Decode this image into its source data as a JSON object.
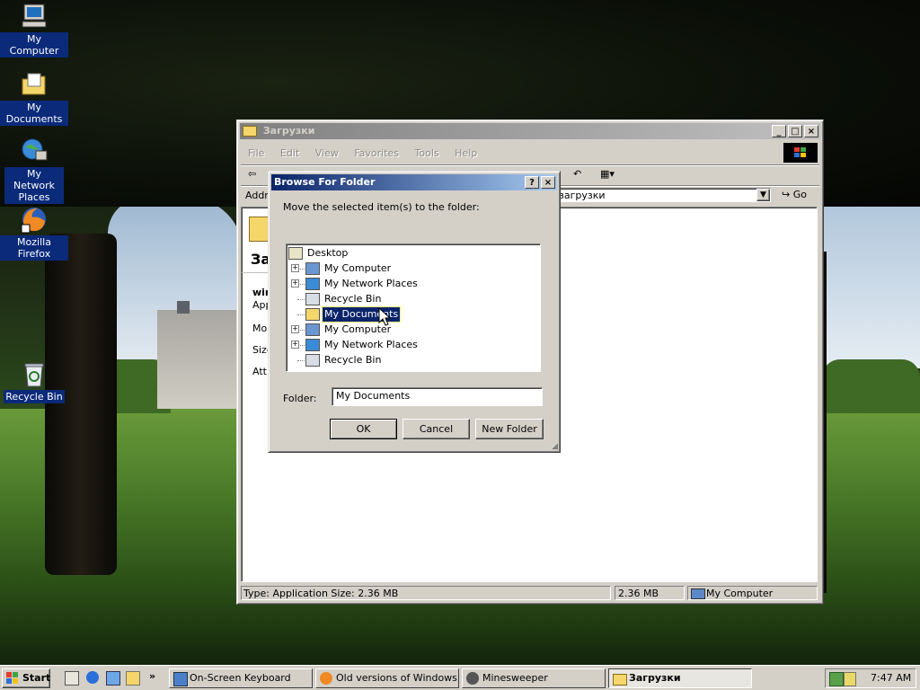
{
  "desktop": {
    "icons": [
      {
        "label": "My Computer",
        "icon": "my-computer-icon"
      },
      {
        "label": "My Documents",
        "icon": "folder-documents-icon"
      },
      {
        "label": "My Network Places",
        "icon": "network-places-icon"
      },
      {
        "label": "Mozilla Firefox",
        "icon": "firefox-icon"
      },
      {
        "label": "Recycle Bin",
        "icon": "recycle-bin-icon"
      }
    ]
  },
  "explorer": {
    "title": "Загрузки",
    "menu": [
      "File",
      "Edit",
      "View",
      "Favorites",
      "Tools",
      "Help"
    ],
    "address_label": "Addr",
    "address_value": "загрузки",
    "go_label": "Go",
    "left_pane": {
      "folder_label_partial": "За",
      "file_name_partial": "win",
      "file_type_partial": "App",
      "modified_partial": "Mo",
      "size_partial": "Size",
      "attributes_partial": "Attr"
    },
    "status": {
      "type_size": "Type: Application Size: 2.36 MB",
      "size": "2.36 MB",
      "zone": "My Computer"
    }
  },
  "dialog": {
    "title": "Browse For Folder",
    "help_btn": "?",
    "close_btn": "×",
    "instruction": "Move the selected item(s) to the folder:",
    "tree": [
      {
        "label": "Desktop",
        "icon": "desktop-icon",
        "level": 0,
        "expander": false,
        "selected": false
      },
      {
        "label": "My Computer",
        "icon": "my-computer-icon",
        "level": 1,
        "expander": true,
        "selected": false
      },
      {
        "label": "My Network Places",
        "icon": "network-places-icon",
        "level": 1,
        "expander": true,
        "selected": false
      },
      {
        "label": "Recycle Bin",
        "icon": "recycle-bin-icon",
        "level": 1,
        "expander": false,
        "selected": false
      },
      {
        "label": "My Documents",
        "icon": "folder-open-icon",
        "level": 1,
        "expander": false,
        "selected": true
      },
      {
        "label": "My Computer",
        "icon": "my-computer-icon",
        "level": 1,
        "expander": true,
        "selected": false
      },
      {
        "label": "My Network Places",
        "icon": "network-places-icon",
        "level": 1,
        "expander": true,
        "selected": false
      },
      {
        "label": "Recycle Bin",
        "icon": "recycle-bin-icon",
        "level": 1,
        "expander": false,
        "selected": false
      }
    ],
    "folder_label": "Folder:",
    "folder_value": "My Documents",
    "ok": "OK",
    "cancel": "Cancel",
    "new_folder": "New Folder"
  },
  "taskbar": {
    "start": "Start",
    "tasks": [
      {
        "label": "On-Screen Keyboard",
        "icon": "keyboard-icon",
        "active": false
      },
      {
        "label": "Old versions of Windows, ...",
        "icon": "firefox-icon",
        "active": false
      },
      {
        "label": "Minesweeper",
        "icon": "mine-icon",
        "active": false
      },
      {
        "label": "Загрузки",
        "icon": "folder-icon",
        "active": true
      }
    ],
    "clock": "7:47 AM"
  },
  "colors": {
    "title_active_start": "#0a246a",
    "title_active_end": "#a6caf0",
    "title_inactive_start": "#808080",
    "title_inactive_end": "#c0c0c0",
    "selection": "#0a246a"
  }
}
